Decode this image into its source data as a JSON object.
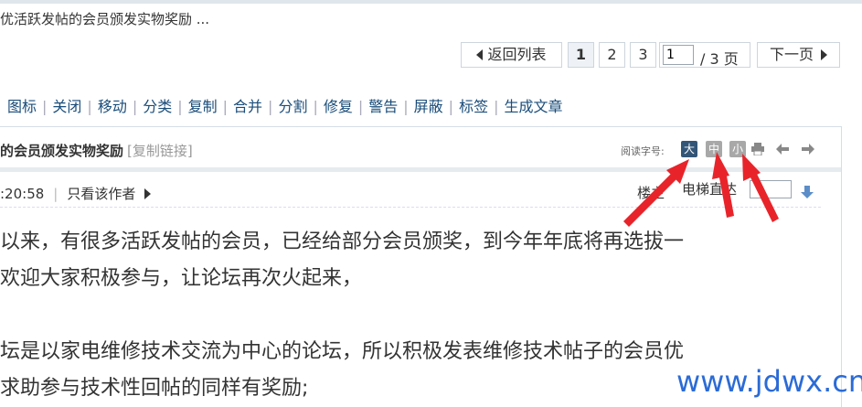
{
  "thread_notice": "优活跃发帖的会员颁发实物奖励 ...",
  "pager": {
    "back_label": "返回列表",
    "pages": [
      "1",
      "2",
      "3"
    ],
    "current_page": "1",
    "page_input_value": "1",
    "total_label": "/ 3 页",
    "next_label": "下一页"
  },
  "admin_actions": [
    "图标",
    "关闭",
    "移动",
    "分类",
    "复制",
    "合并",
    "分割",
    "修复",
    "警告",
    "屏蔽",
    "标签",
    "生成文章"
  ],
  "post": {
    "title": "的会员颁发实物奖励",
    "copy_link": "[复制链接]",
    "font_size_label": "阅读字号:",
    "font_sizes": [
      "大",
      "中",
      "小"
    ],
    "time": ":20:58",
    "only_author": "只看该作者",
    "floor_label": "楼主",
    "elevator_label": "电梯直达",
    "lines": [
      "以来，有很多活跃发帖的会员，已经给部分会员颁奖，到今年年底将再选拔一",
      "欢迎大家积极参与，让论坛再次火起来，",
      "坛是以家电维修技术交流为中心的论坛，所以积极发表维修技术帖子的会员优",
      "求助参与技术性回帖的同样有奖励;"
    ]
  },
  "watermark": "www.jdwx.cn",
  "colors": {
    "link": "#1a4d7a",
    "font_large_bg": "#335577",
    "font_inactive_bg": "#a8a8a8",
    "arrow": "#e8242a",
    "watermark": "#2b6bd6"
  }
}
